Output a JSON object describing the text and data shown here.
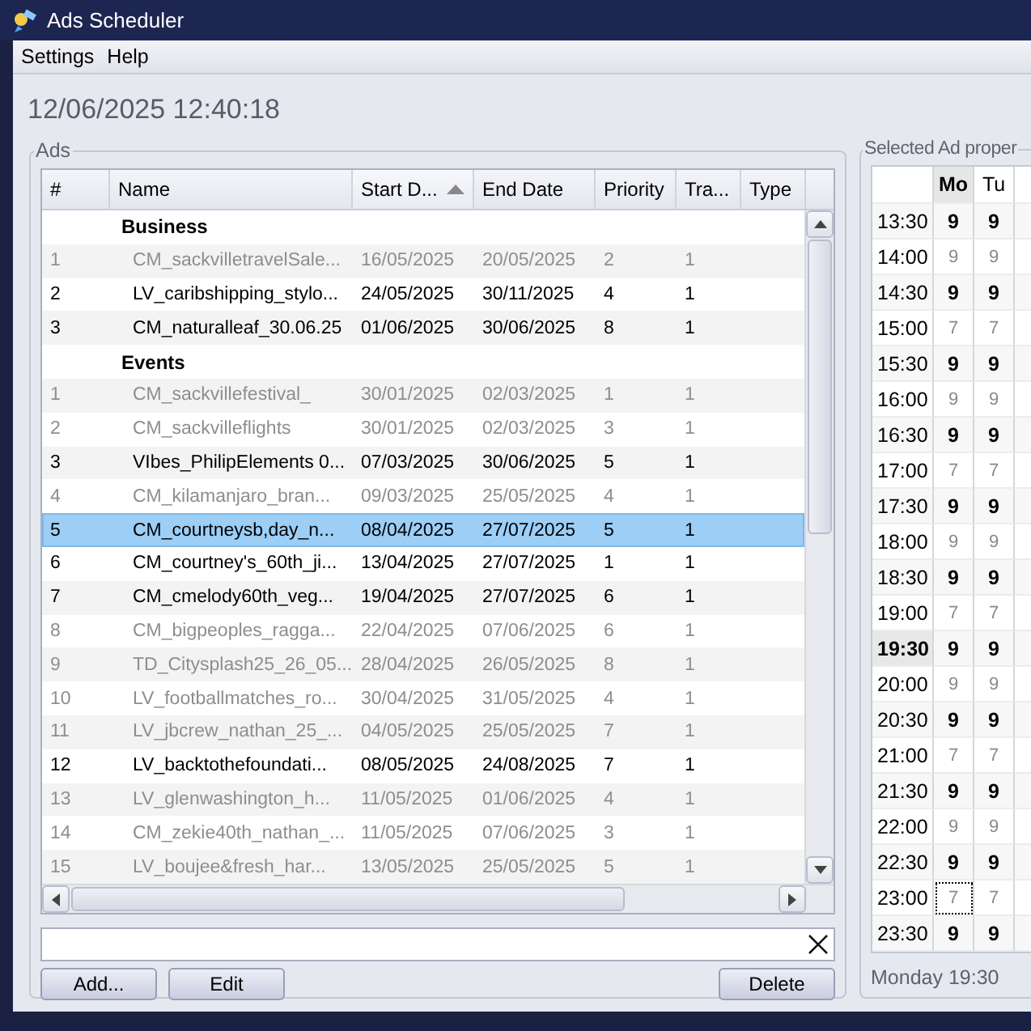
{
  "window": {
    "title": "Ads Scheduler"
  },
  "menu": [
    {
      "label": "Settings"
    },
    {
      "label": "Help"
    }
  ],
  "clock": "12/06/2025 12:40:18",
  "ads": {
    "title": "Ads",
    "columns": [
      {
        "label": "#"
      },
      {
        "label": "Name"
      },
      {
        "label": "Start D...",
        "sorted_ascending": true
      },
      {
        "label": "End Date"
      },
      {
        "label": "Priority"
      },
      {
        "label": "Tra..."
      },
      {
        "label": "Type"
      }
    ],
    "groups": [
      {
        "name": "Business",
        "rows": [
          {
            "cells": [
              "1",
              "CM_sackvilletravelSale...",
              "16/05/2025",
              "20/05/2025",
              "2",
              "1"
            ],
            "active": false,
            "selected": false
          },
          {
            "cells": [
              "2",
              "LV_caribshipping_stylo...",
              "24/05/2025",
              "30/11/2025",
              "4",
              "1"
            ],
            "active": true,
            "selected": false
          },
          {
            "cells": [
              "3",
              "CM_naturalleaf_30.06.25",
              "01/06/2025",
              "30/06/2025",
              "8",
              "1"
            ],
            "active": true,
            "selected": false
          }
        ]
      },
      {
        "name": "Events",
        "rows": [
          {
            "cells": [
              "1",
              "CM_sackvillefestival_",
              "30/01/2025",
              "02/03/2025",
              "1",
              "1"
            ],
            "active": false,
            "selected": false
          },
          {
            "cells": [
              "2",
              "CM_sackvilleflights",
              "30/01/2025",
              "02/03/2025",
              "3",
              "1"
            ],
            "active": false,
            "selected": false
          },
          {
            "cells": [
              "3",
              "VIbes_PhilipElements 0...",
              "07/03/2025",
              "30/06/2025",
              "5",
              "1"
            ],
            "active": true,
            "selected": false
          },
          {
            "cells": [
              "4",
              "CM_kilamanjaro_bran...",
              "09/03/2025",
              "25/05/2025",
              "4",
              "1"
            ],
            "active": false,
            "selected": false
          },
          {
            "cells": [
              "5",
              "CM_courtneysb,day_n...",
              "08/04/2025",
              "27/07/2025",
              "5",
              "1"
            ],
            "active": true,
            "selected": true
          },
          {
            "cells": [
              "6",
              "CM_courtney's_60th_ji...",
              "13/04/2025",
              "27/07/2025",
              "1",
              "1"
            ],
            "active": true,
            "selected": false
          },
          {
            "cells": [
              "7",
              "CM_cmelody60th_veg...",
              "19/04/2025",
              "27/07/2025",
              "6",
              "1"
            ],
            "active": true,
            "selected": false
          },
          {
            "cells": [
              "8",
              "CM_bigpeoples_ragga...",
              "22/04/2025",
              "07/06/2025",
              "6",
              "1"
            ],
            "active": false,
            "selected": false
          },
          {
            "cells": [
              "9",
              "TD_Citysplash25_26_05...",
              "28/04/2025",
              "26/05/2025",
              "8",
              "1"
            ],
            "active": false,
            "selected": false
          },
          {
            "cells": [
              "10",
              "LV_footballmatches_ro...",
              "30/04/2025",
              "31/05/2025",
              "4",
              "1"
            ],
            "active": false,
            "selected": false
          },
          {
            "cells": [
              "11",
              "LV_jbcrew_nathan_25_...",
              "04/05/2025",
              "25/05/2025",
              "7",
              "1"
            ],
            "active": false,
            "selected": false
          },
          {
            "cells": [
              "12",
              "LV_backtothefoundati...",
              "08/05/2025",
              "24/08/2025",
              "7",
              "1"
            ],
            "active": true,
            "selected": false
          },
          {
            "cells": [
              "13",
              "LV_glenwashington_h...",
              "11/05/2025",
              "01/06/2025",
              "4",
              "1"
            ],
            "active": false,
            "selected": false
          },
          {
            "cells": [
              "14",
              "CM_zekie40th_nathan_...",
              "11/05/2025",
              "07/06/2025",
              "3",
              "1"
            ],
            "active": false,
            "selected": false
          },
          {
            "cells": [
              "15",
              "LV_boujee&fresh_har...",
              "13/05/2025",
              "25/05/2025",
              "5",
              "1"
            ],
            "active": false,
            "selected": false
          }
        ]
      }
    ]
  },
  "buttons_left": [
    {
      "label": "Add..."
    },
    {
      "label": "Edit"
    }
  ],
  "buttons_right": [
    {
      "label": "Delete"
    }
  ],
  "schedule": {
    "title": "Selected Ad proper",
    "days": [
      {
        "label": "Mo",
        "selected": true
      },
      {
        "label": "Tu",
        "selected": false
      }
    ],
    "slots": [
      {
        "time": "13:30",
        "selected": false,
        "cells": [
          {
            "value": "9",
            "active": true,
            "focused": false
          },
          {
            "value": "9",
            "active": true,
            "focused": false
          }
        ]
      },
      {
        "time": "14:00",
        "selected": false,
        "cells": [
          {
            "value": "9",
            "active": false,
            "focused": false
          },
          {
            "value": "9",
            "active": false,
            "focused": false
          }
        ]
      },
      {
        "time": "14:30",
        "selected": false,
        "cells": [
          {
            "value": "9",
            "active": true,
            "focused": false
          },
          {
            "value": "9",
            "active": true,
            "focused": false
          }
        ]
      },
      {
        "time": "15:00",
        "selected": false,
        "cells": [
          {
            "value": "7",
            "active": false,
            "focused": false
          },
          {
            "value": "7",
            "active": false,
            "focused": false
          }
        ]
      },
      {
        "time": "15:30",
        "selected": false,
        "cells": [
          {
            "value": "9",
            "active": true,
            "focused": false
          },
          {
            "value": "9",
            "active": true,
            "focused": false
          }
        ]
      },
      {
        "time": "16:00",
        "selected": false,
        "cells": [
          {
            "value": "9",
            "active": false,
            "focused": false
          },
          {
            "value": "9",
            "active": false,
            "focused": false
          }
        ]
      },
      {
        "time": "16:30",
        "selected": false,
        "cells": [
          {
            "value": "9",
            "active": true,
            "focused": false
          },
          {
            "value": "9",
            "active": true,
            "focused": false
          }
        ]
      },
      {
        "time": "17:00",
        "selected": false,
        "cells": [
          {
            "value": "7",
            "active": false,
            "focused": false
          },
          {
            "value": "7",
            "active": false,
            "focused": false
          }
        ]
      },
      {
        "time": "17:30",
        "selected": false,
        "cells": [
          {
            "value": "9",
            "active": true,
            "focused": false
          },
          {
            "value": "9",
            "active": true,
            "focused": false
          }
        ]
      },
      {
        "time": "18:00",
        "selected": false,
        "cells": [
          {
            "value": "9",
            "active": false,
            "focused": false
          },
          {
            "value": "9",
            "active": false,
            "focused": false
          }
        ]
      },
      {
        "time": "18:30",
        "selected": false,
        "cells": [
          {
            "value": "9",
            "active": true,
            "focused": false
          },
          {
            "value": "9",
            "active": true,
            "focused": false
          }
        ]
      },
      {
        "time": "19:00",
        "selected": false,
        "cells": [
          {
            "value": "7",
            "active": false,
            "focused": false
          },
          {
            "value": "7",
            "active": false,
            "focused": false
          }
        ]
      },
      {
        "time": "19:30",
        "selected": true,
        "cells": [
          {
            "value": "9",
            "active": true,
            "focused": false
          },
          {
            "value": "9",
            "active": true,
            "focused": false
          }
        ]
      },
      {
        "time": "20:00",
        "selected": false,
        "cells": [
          {
            "value": "9",
            "active": false,
            "focused": false
          },
          {
            "value": "9",
            "active": false,
            "focused": false
          }
        ]
      },
      {
        "time": "20:30",
        "selected": false,
        "cells": [
          {
            "value": "9",
            "active": true,
            "focused": false
          },
          {
            "value": "9",
            "active": true,
            "focused": false
          }
        ]
      },
      {
        "time": "21:00",
        "selected": false,
        "cells": [
          {
            "value": "7",
            "active": false,
            "focused": false
          },
          {
            "value": "7",
            "active": false,
            "focused": false
          }
        ]
      },
      {
        "time": "21:30",
        "selected": false,
        "cells": [
          {
            "value": "9",
            "active": true,
            "focused": false
          },
          {
            "value": "9",
            "active": true,
            "focused": false
          }
        ]
      },
      {
        "time": "22:00",
        "selected": false,
        "cells": [
          {
            "value": "9",
            "active": false,
            "focused": false
          },
          {
            "value": "9",
            "active": false,
            "focused": false
          }
        ]
      },
      {
        "time": "22:30",
        "selected": false,
        "cells": [
          {
            "value": "9",
            "active": true,
            "focused": false
          },
          {
            "value": "9",
            "active": true,
            "focused": false
          }
        ]
      },
      {
        "time": "23:00",
        "selected": false,
        "cells": [
          {
            "value": "7",
            "active": false,
            "focused": true
          },
          {
            "value": "7",
            "active": false,
            "focused": false
          }
        ]
      },
      {
        "time": "23:30",
        "selected": false,
        "cells": [
          {
            "value": "9",
            "active": true,
            "focused": false
          },
          {
            "value": "9",
            "active": true,
            "focused": false
          }
        ]
      }
    ],
    "status": "Monday 19:30"
  }
}
